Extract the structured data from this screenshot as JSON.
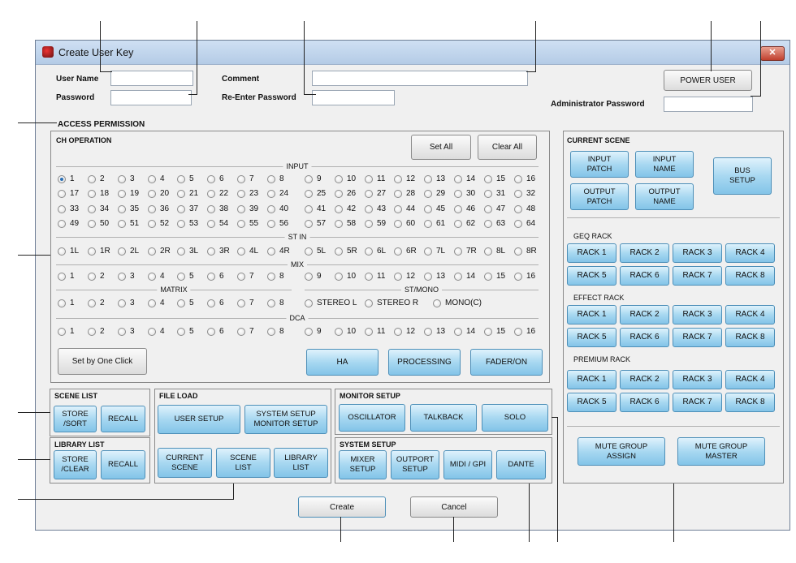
{
  "window": {
    "title": "Create User Key",
    "close_glyph": "✕"
  },
  "fields": {
    "user_name_label": "User Name",
    "password_label": "Password",
    "comment_label": "Comment",
    "reenter_password_label": "Re-Enter Password",
    "admin_password_label": "Administrator Password"
  },
  "buttons": {
    "power_user": "POWER USER",
    "create": "Create",
    "cancel": "Cancel"
  },
  "access_permission": "ACCESS PERMISSION",
  "ch_operation": {
    "title": "CH OPERATION",
    "set_all": "Set All",
    "clear_all": "Clear All",
    "selected": "1",
    "input_label": "INPUT",
    "input": [
      [
        "1",
        "2",
        "3",
        "4",
        "5",
        "6",
        "7",
        "8",
        "9",
        "10",
        "11",
        "12",
        "13",
        "14",
        "15",
        "16"
      ],
      [
        "17",
        "18",
        "19",
        "20",
        "21",
        "22",
        "23",
        "24",
        "25",
        "26",
        "27",
        "28",
        "29",
        "30",
        "31",
        "32"
      ],
      [
        "33",
        "34",
        "35",
        "36",
        "37",
        "38",
        "39",
        "40",
        "41",
        "42",
        "43",
        "44",
        "45",
        "46",
        "47",
        "48"
      ],
      [
        "49",
        "50",
        "51",
        "52",
        "53",
        "54",
        "55",
        "56",
        "57",
        "58",
        "59",
        "60",
        "61",
        "62",
        "63",
        "64"
      ]
    ],
    "stin_label": "ST IN",
    "stin": [
      "1L",
      "1R",
      "2L",
      "2R",
      "3L",
      "3R",
      "4L",
      "4R",
      "5L",
      "5R",
      "6L",
      "6R",
      "7L",
      "7R",
      "8L",
      "8R"
    ],
    "mix_label": "MIX",
    "mix": [
      "1",
      "2",
      "3",
      "4",
      "5",
      "6",
      "7",
      "8",
      "9",
      "10",
      "11",
      "12",
      "13",
      "14",
      "15",
      "16"
    ],
    "matrix_label": "MATRIX",
    "matrix": [
      "1",
      "2",
      "3",
      "4",
      "5",
      "6",
      "7",
      "8"
    ],
    "stmono_label": "ST/MONO",
    "stmono": [
      "STEREO L",
      "STEREO R",
      "MONO(C)"
    ],
    "dca_label": "DCA",
    "dca": [
      "1",
      "2",
      "3",
      "4",
      "5",
      "6",
      "7",
      "8",
      "9",
      "10",
      "11",
      "12",
      "13",
      "14",
      "15",
      "16"
    ],
    "set_by_one_click": "Set by One Click",
    "ha": "HA",
    "processing": "PROCESSING",
    "fader_on": "FADER/ON"
  },
  "scene_list": {
    "title": "SCENE LIST",
    "store_sort": [
      "STORE",
      "/SORT"
    ],
    "recall": "RECALL"
  },
  "library_list": {
    "title": "LIBRARY LIST",
    "store_clear": [
      "STORE",
      "/CLEAR"
    ],
    "recall": "RECALL"
  },
  "file_load": {
    "title": "FILE LOAD",
    "user_setup": "USER SETUP",
    "system_setup_monitor": [
      "SYSTEM SETUP",
      "MONITOR SETUP"
    ],
    "current_scene": [
      "CURRENT",
      "SCENE"
    ],
    "scene_list": [
      "SCENE",
      "LIST"
    ],
    "library_list": [
      "LIBRARY",
      "LIST"
    ]
  },
  "monitor_setup": {
    "title": "MONITOR SETUP",
    "oscillator": "OSCILLATOR",
    "talkback": "TALKBACK",
    "solo": "SOLO"
  },
  "system_setup": {
    "title": "SYSTEM SETUP",
    "mixer_setup": [
      "MIXER",
      "SETUP"
    ],
    "outport_setup": [
      "OUTPORT",
      "SETUP"
    ],
    "midi_gpi": "MIDI / GPI",
    "dante": "DANTE"
  },
  "current_scene": {
    "title": "CURRENT SCENE",
    "input_patch": [
      "INPUT",
      "PATCH"
    ],
    "input_name": [
      "INPUT",
      "NAME"
    ],
    "output_patch": [
      "OUTPUT",
      "PATCH"
    ],
    "output_name": [
      "OUTPUT",
      "NAME"
    ],
    "bus_setup": [
      "BUS",
      "SETUP"
    ],
    "geq_rack_label": "GEQ RACK",
    "effect_rack_label": "EFFECT RACK",
    "premium_rack_label": "PREMIUM RACK",
    "racks": [
      "RACK 1",
      "RACK 2",
      "RACK 3",
      "RACK 4",
      "RACK 5",
      "RACK 6",
      "RACK 7",
      "RACK 8"
    ],
    "mute_group_assign": [
      "MUTE GROUP",
      "ASSIGN"
    ],
    "mute_group_master": [
      "MUTE GROUP",
      "MASTER"
    ]
  }
}
